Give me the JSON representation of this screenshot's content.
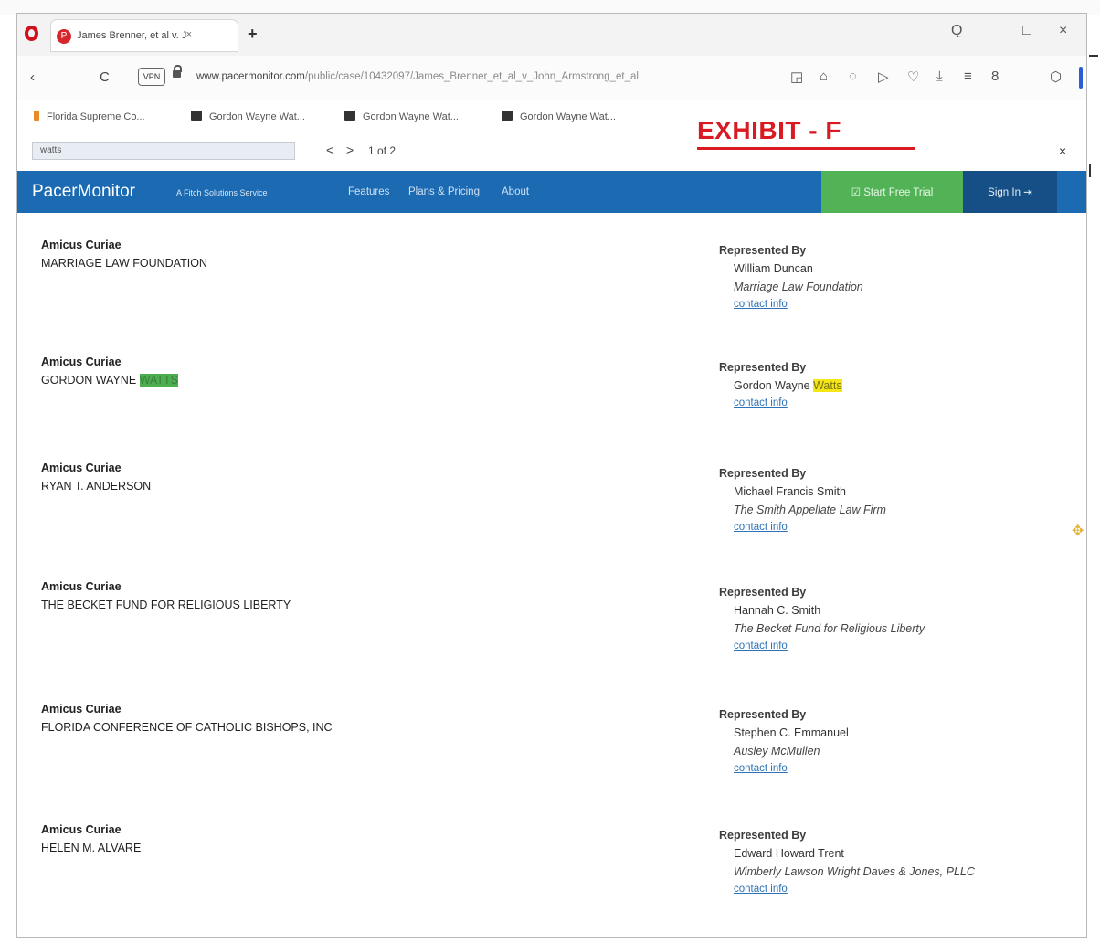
{
  "browser": {
    "tab_title": "James Brenner, et al v. Jo",
    "new_tab": "+",
    "window_controls": {
      "search": "Q",
      "minimize": "_",
      "maximize": "□",
      "close": "×"
    },
    "nav": {
      "back": "‹",
      "reload": "C"
    },
    "badge": "VPN",
    "url_host": "www.pacermonitor.com",
    "url_path": "/public/case/10432097/James_Brenner_et_al_v_John_Armstrong_et_al",
    "bookmarks": [
      "Florida Supreme Co...",
      "Gordon Wayne Wat...",
      "Gordon Wayne Wat...",
      "Gordon Wayne Wat..."
    ]
  },
  "find_bar": {
    "query": "watts",
    "prev": "<",
    "next": ">",
    "count": "1 of 2",
    "close": "×"
  },
  "annotation": {
    "exhibit": "EXHIBIT - F"
  },
  "site": {
    "brand": "PacerMonitor",
    "tagline": "A Fitch Solutions Service",
    "nav": [
      "Features",
      "Plans & Pricing",
      "About"
    ],
    "trial_button": "Start Free Trial",
    "signin_button": "Sign In"
  },
  "parties": [
    {
      "role": "Amicus Curiae",
      "name": "MARRIAGE LAW FOUNDATION",
      "rep_label": "Represented By",
      "attorney": "William Duncan",
      "firm": "Marriage Law Foundation",
      "link": "contact info"
    },
    {
      "role": "Amicus Curiae",
      "name_prefix": "GORDON WAYNE ",
      "name_highlight": "WATTS",
      "rep_label": "Represented By",
      "attorney_prefix": "Gordon Wayne ",
      "attorney_highlight": "Watts",
      "link": "contact info"
    },
    {
      "role": "Amicus Curiae",
      "name": "RYAN T. ANDERSON",
      "rep_label": "Represented By",
      "attorney": "Michael Francis Smith",
      "firm": "The Smith Appellate Law Firm",
      "link": "contact info"
    },
    {
      "role": "Amicus Curiae",
      "name": "THE BECKET FUND FOR RELIGIOUS LIBERTY",
      "rep_label": "Represented By",
      "attorney": "Hannah C. Smith",
      "firm": "The Becket Fund for Religious Liberty",
      "link": "contact info"
    },
    {
      "role": "Amicus Curiae",
      "name": "FLORIDA CONFERENCE OF CATHOLIC BISHOPS, INC",
      "rep_label": "Represented By",
      "attorney": "Stephen C. Emmanuel",
      "firm": "Ausley McMullen",
      "link": "contact info"
    },
    {
      "role": "Amicus Curiae",
      "name": "HELEN M. ALVARE",
      "rep_label": "Represented By",
      "attorney": "Edward Howard Trent",
      "firm": "Wimberly Lawson Wright Daves & Jones, PLLC",
      "link": "contact info"
    }
  ]
}
